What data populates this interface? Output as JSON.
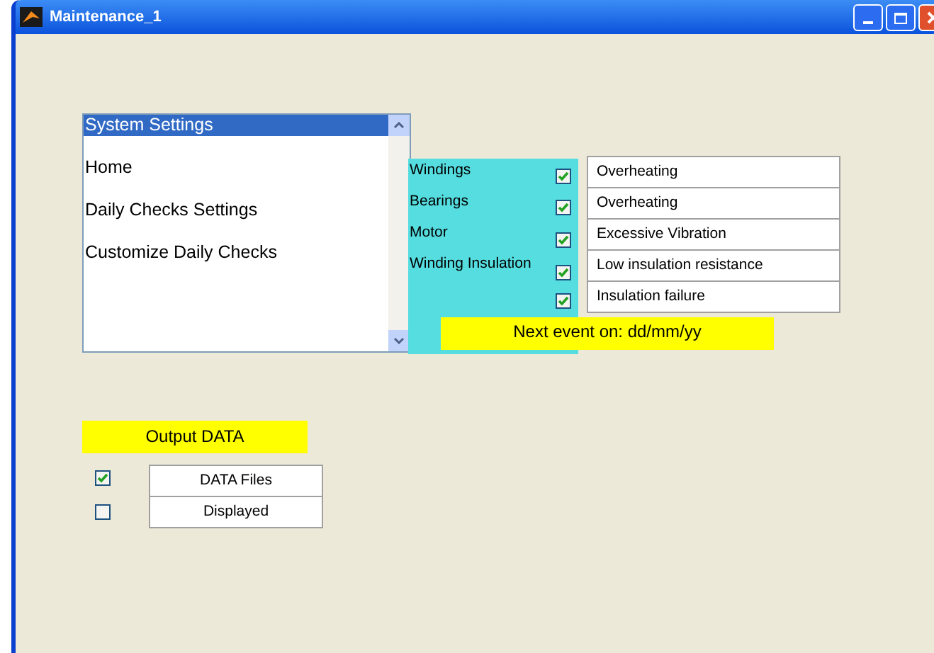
{
  "window": {
    "title": "Maintenance_1"
  },
  "menu_list": {
    "items": [
      {
        "label": "System Settings",
        "selected": true
      },
      {
        "label": "Home",
        "selected": false
      },
      {
        "label": "Daily Checks Settings",
        "selected": false
      },
      {
        "label": "Customize Daily Checks",
        "selected": false
      }
    ]
  },
  "checks": [
    {
      "component": "Windings",
      "checked": true,
      "fault": "Overheating"
    },
    {
      "component": "Bearings",
      "checked": true,
      "fault": "Overheating"
    },
    {
      "component": "Motor",
      "checked": true,
      "fault": "Excessive Vibration"
    },
    {
      "component": "Winding Insulation",
      "checked": true,
      "fault": "Low insulation resistance"
    },
    {
      "checked": true,
      "fault": "Insulation failure"
    }
  ],
  "next_event": "Next event on: dd/mm/yy",
  "output": {
    "title": "Output DATA",
    "rows": [
      {
        "label": "DATA Files",
        "checked": true
      },
      {
        "label": "Displayed",
        "checked": false
      }
    ]
  }
}
